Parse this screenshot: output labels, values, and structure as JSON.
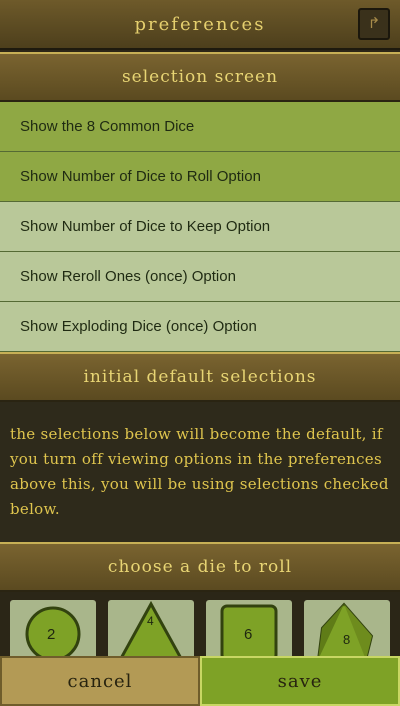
{
  "header": {
    "title": "Preferences",
    "corner_icon": "share-arrow-icon"
  },
  "selection": {
    "heading": "Selection Screen",
    "options": [
      {
        "label": "Show the 8 Common Dice",
        "enabled": true
      },
      {
        "label": "Show Number of Dice to Roll Option",
        "enabled": true
      },
      {
        "label": "Show Number of Dice to Keep Option",
        "enabled": false
      },
      {
        "label": "Show Reroll Ones (once) Option",
        "enabled": false
      },
      {
        "label": "Show Exploding Dice (once) Option",
        "enabled": false
      }
    ]
  },
  "defaults": {
    "heading": "Initial Default Selections",
    "description": "The selections below will become the default, if you turn off viewing options in the preferences above this, you will be using selections checked below."
  },
  "dice": {
    "heading": "Choose a Die to Roll",
    "items": [
      {
        "label": "2",
        "shape": "coin"
      },
      {
        "label": "4",
        "shape": "triangle"
      },
      {
        "label": "6",
        "shape": "square"
      },
      {
        "label": "8",
        "shape": "octahedron"
      }
    ]
  },
  "footer": {
    "cancel_label": "cancel",
    "save_label": "save"
  },
  "colors": {
    "option_on": "#8fa844",
    "option_off": "#b9c899",
    "accent_gold": "#e5cf6e",
    "save_green": "#7ea226"
  }
}
